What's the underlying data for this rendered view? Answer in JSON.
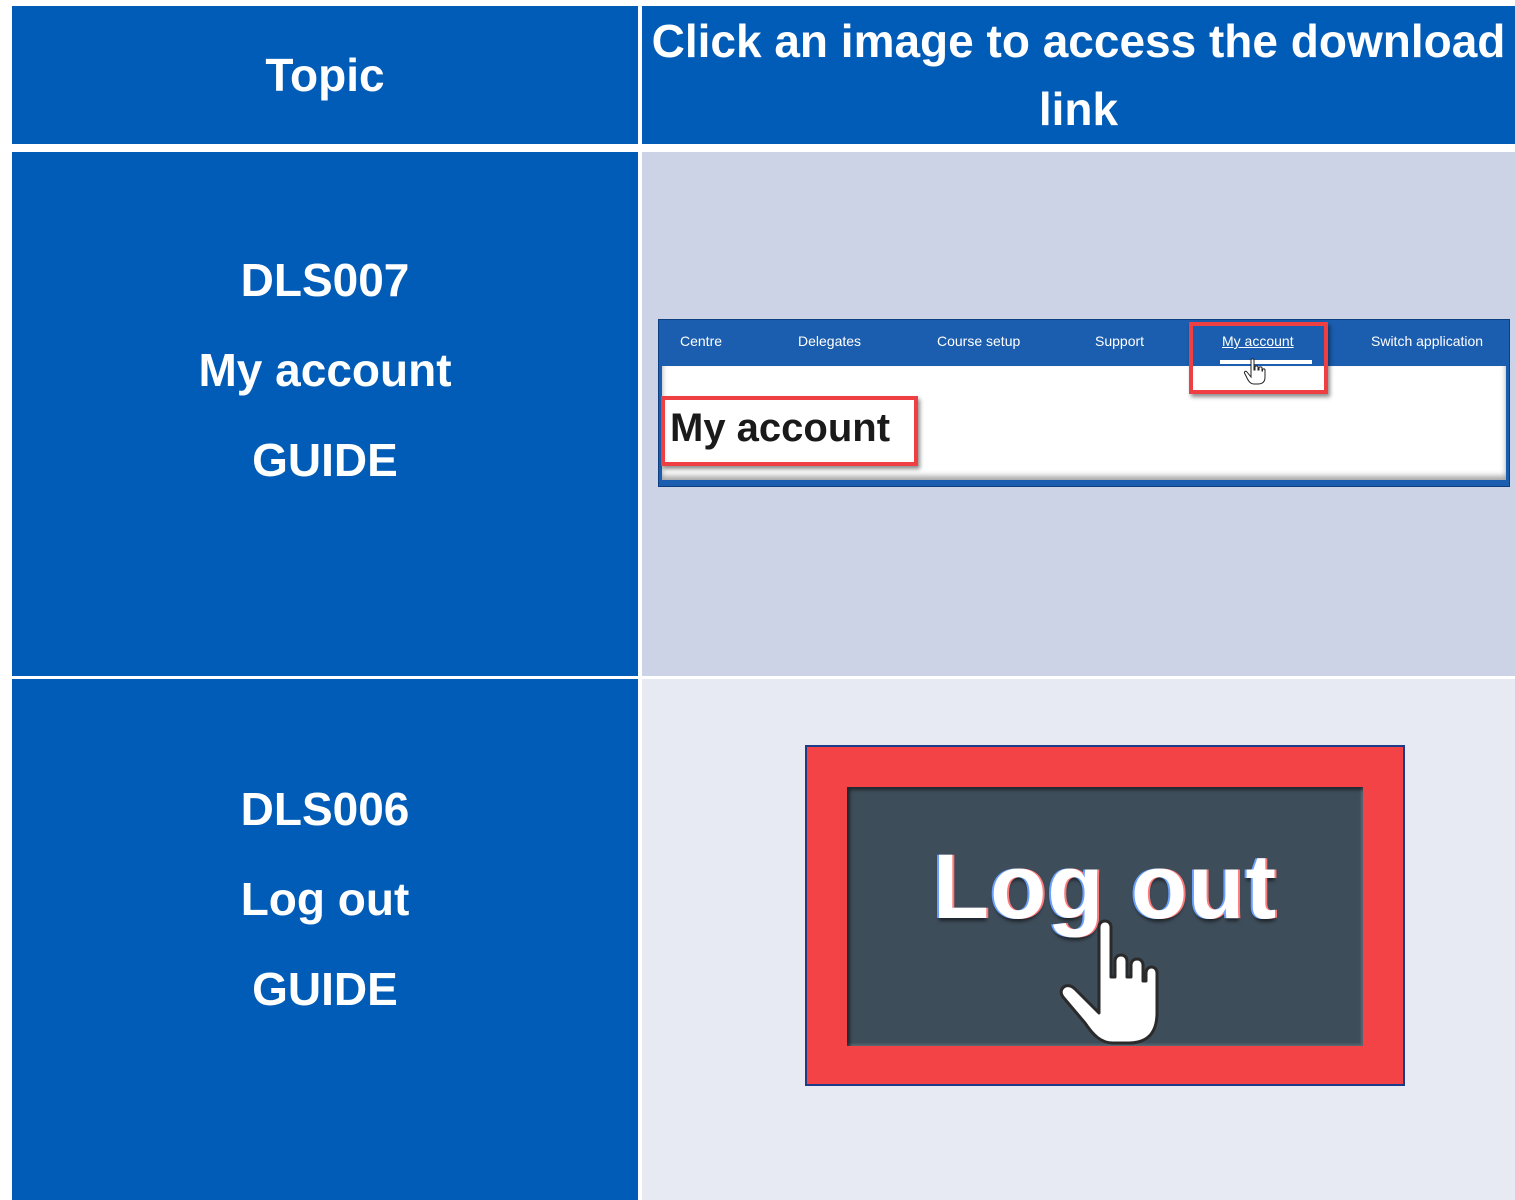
{
  "header": {
    "topic": "Topic",
    "click_instruction": "Click an image to access the download link"
  },
  "rows": [
    {
      "code": "DLS007",
      "name": "My account",
      "type": "GUIDE",
      "thumbnail": {
        "nav_items": [
          "Centre",
          "Delegates",
          "Course setup",
          "Support",
          "My account",
          "Switch application"
        ],
        "heading": "My account"
      }
    },
    {
      "code": "DLS006",
      "name": "Log out",
      "type": "GUIDE",
      "thumbnail": {
        "button_label": "Log out"
      }
    }
  ],
  "colors": {
    "header_blue": "#015cb8",
    "row1_bg": "#cdd3e6",
    "row2_bg": "#e7e9f3",
    "highlight_red": "#ee3f42"
  },
  "icons": [
    "hand-pointer-icon"
  ]
}
